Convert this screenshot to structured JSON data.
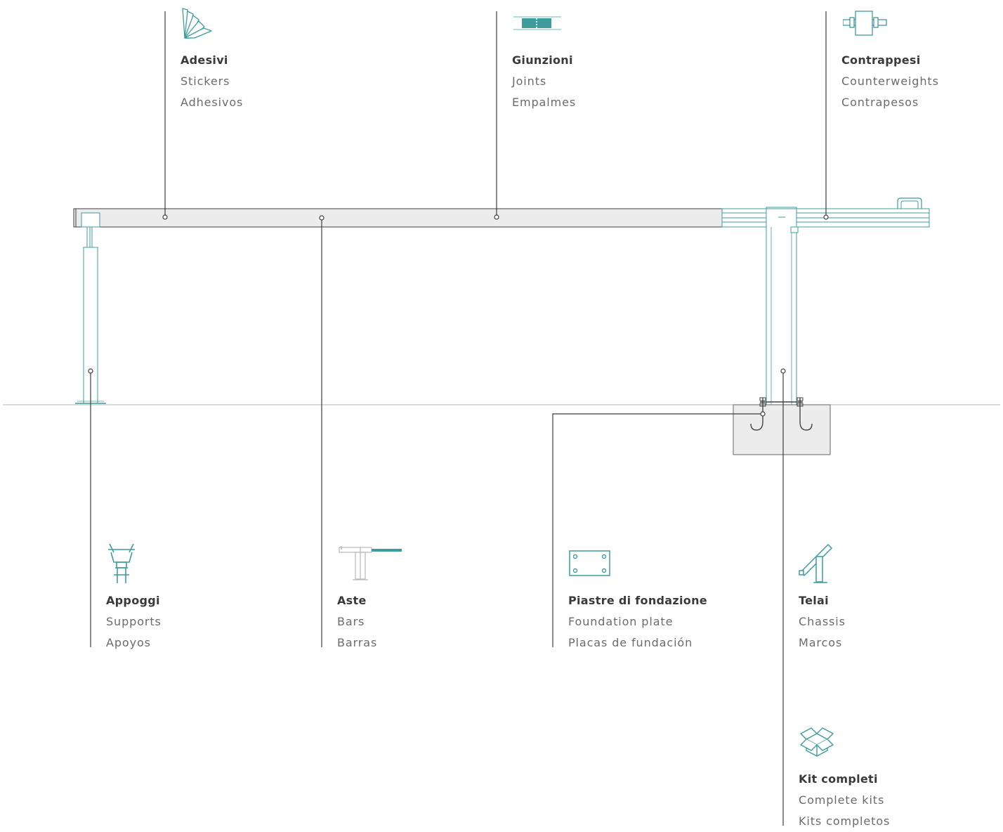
{
  "colors": {
    "accent": "#3f9c9c",
    "line": "#3c3c3c",
    "ground": "#b4b4b4",
    "fill": "#ececec"
  },
  "parts": {
    "adesivi": {
      "name": "Adesivi",
      "en": "Stickers",
      "es": "Adhesivos",
      "icon": "stickers-icon"
    },
    "giunzioni": {
      "name": "Giunzioni",
      "en": "Joints",
      "es": "Empalmes",
      "icon": "joint-icon"
    },
    "contrappesi": {
      "name": "Contrappesi",
      "en": "Counterweights",
      "es": "Contrapesos",
      "icon": "counterweight-icon"
    },
    "appoggi": {
      "name": "Appoggi",
      "en": "Supports",
      "es": "Apoyos",
      "icon": "support-icon"
    },
    "aste": {
      "name": "Aste",
      "en": "Bars",
      "es": "Barras",
      "icon": "bar-icon"
    },
    "piastre": {
      "name": "Piastre di fondazione",
      "en": "Foundation plate",
      "es": "Placas de fundación",
      "icon": "foundation-plate-icon"
    },
    "telai": {
      "name": "Telai",
      "en": "Chassis",
      "es": "Marcos",
      "icon": "chassis-icon"
    },
    "kit": {
      "name": "Kit completi",
      "en": "Complete kits",
      "es": "Kits completos",
      "icon": "box-icon"
    }
  }
}
